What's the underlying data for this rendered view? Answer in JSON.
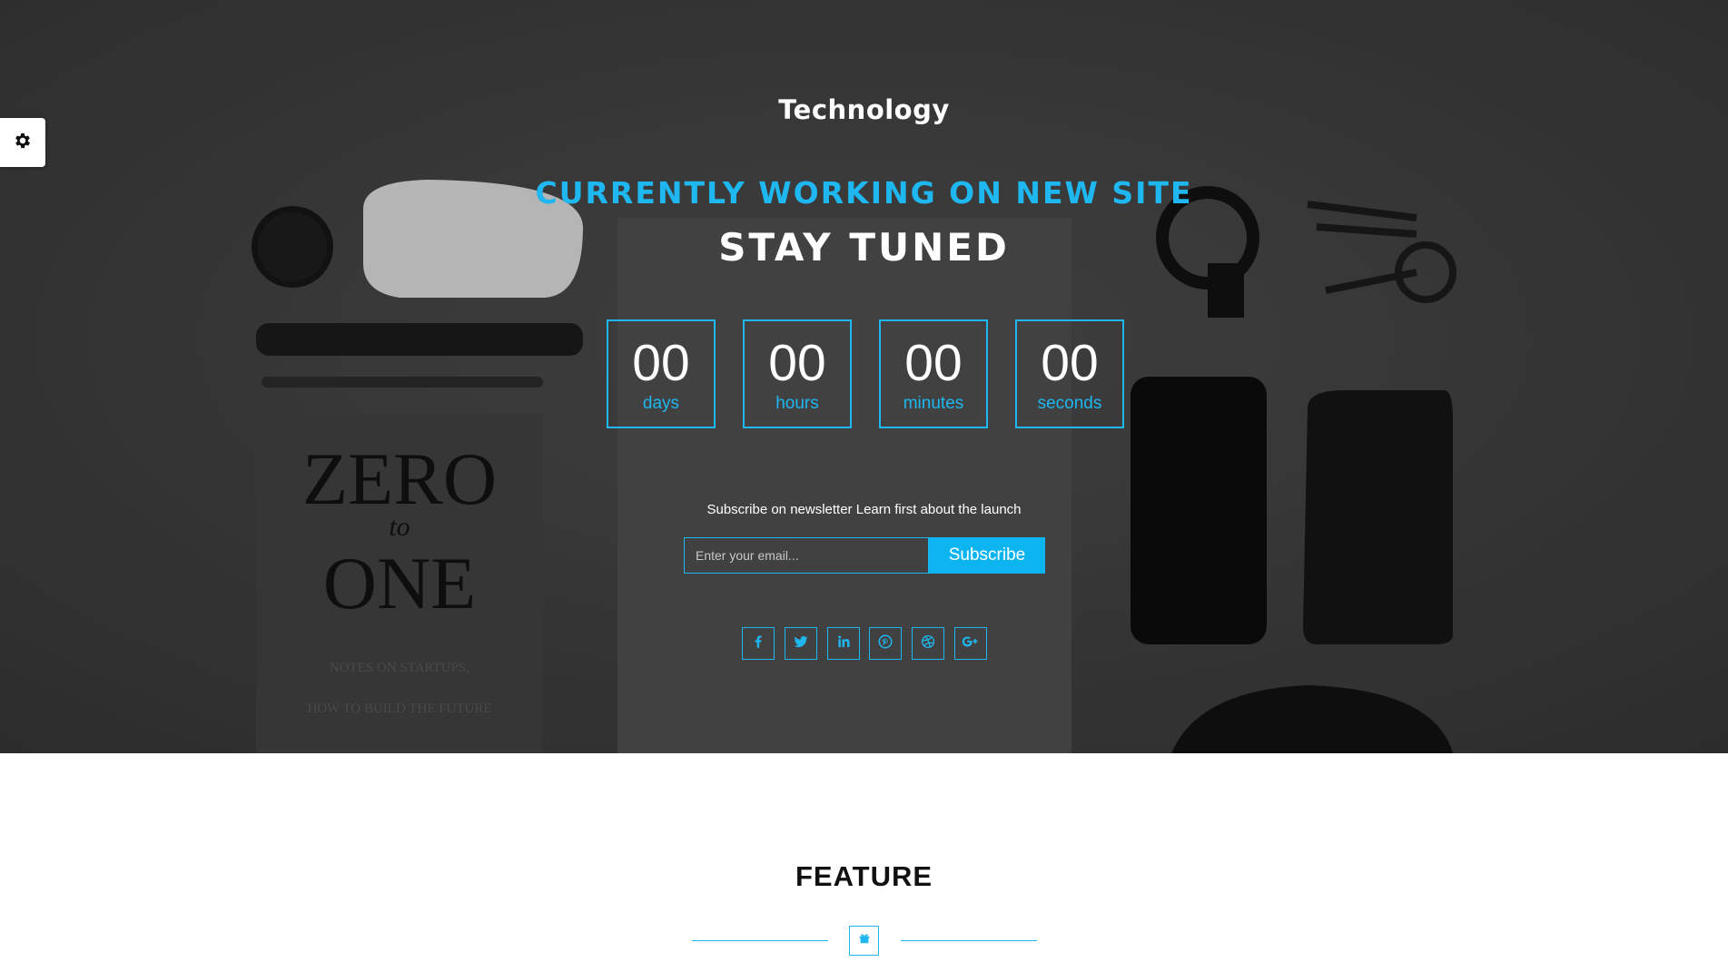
{
  "settings": {
    "icon": "gear-icon"
  },
  "brand": {
    "name": "Technology"
  },
  "hero": {
    "headline": "CURRENTLY WORKING ON NEW SITE",
    "subheadline": "STAY TUNED"
  },
  "countdown": {
    "items": [
      {
        "value": "00",
        "label": "days"
      },
      {
        "value": "00",
        "label": "hours"
      },
      {
        "value": "00",
        "label": "minutes"
      },
      {
        "value": "00",
        "label": "seconds"
      }
    ]
  },
  "newsletter": {
    "text": "Subscribe on newsletter Learn first about the launch",
    "email_placeholder": "Enter your email...",
    "email_value": "",
    "button_label": "Subscribe"
  },
  "socials": [
    {
      "icon": "facebook-icon"
    },
    {
      "icon": "twitter-icon"
    },
    {
      "icon": "linkedin-icon"
    },
    {
      "icon": "pinterest-icon"
    },
    {
      "icon": "dribbble-icon"
    },
    {
      "icon": "google-plus-icon"
    }
  ],
  "feature": {
    "title": "FEATURE",
    "icon": "gift-icon"
  },
  "colors": {
    "accent": "#1eb7f0",
    "hero_background": "#3b3b3b"
  }
}
